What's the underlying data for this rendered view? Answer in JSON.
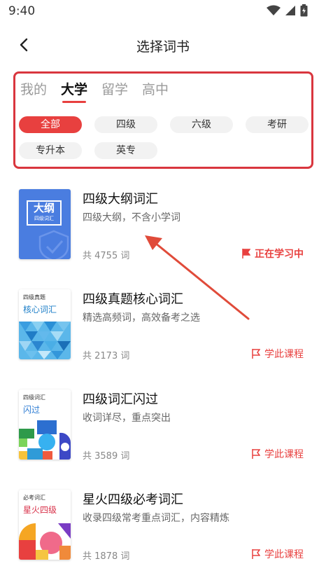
{
  "status": {
    "time": "9:40"
  },
  "nav": {
    "title": "选择词书"
  },
  "tabs": [
    {
      "label": "我的",
      "active": false
    },
    {
      "label": "大学",
      "active": true
    },
    {
      "label": "留学",
      "active": false
    },
    {
      "label": "高中",
      "active": false
    }
  ],
  "chips": [
    {
      "label": "全部",
      "active": true
    },
    {
      "label": "四级",
      "active": false
    },
    {
      "label": "六级",
      "active": false
    },
    {
      "label": "考研",
      "active": false
    },
    {
      "label": "专升本",
      "active": false
    },
    {
      "label": "英专",
      "active": false
    }
  ],
  "books": [
    {
      "title": "四级大纲词汇",
      "desc": "四级大纲，不含小学词",
      "count": "共 4755 词",
      "action": "正在学习中",
      "cover_big": "大纲",
      "cover_small": "四级词汇"
    },
    {
      "title": "四级真题核心词汇",
      "desc": "精选高频词，高效备考之选",
      "count": "共 2173 词",
      "action": "学此课程",
      "cover_top": "四级真题",
      "cover_main": "核心词汇"
    },
    {
      "title": "四级词汇闪过",
      "desc": "收词详尽，重点突出",
      "count": "共 3589 词",
      "action": "学此课程",
      "cover_top": "四级词汇",
      "cover_main": "闪过"
    },
    {
      "title": "星火四级必考词汇",
      "desc": "收录四级常考重点词汇，内容精炼",
      "count": "共 1878 词",
      "action": "学此课程",
      "cover_top": "必考词汇",
      "cover_main": "星火四级"
    }
  ],
  "colors": {
    "accent": "#e8403f",
    "cover_blue": "#4a7de0"
  }
}
